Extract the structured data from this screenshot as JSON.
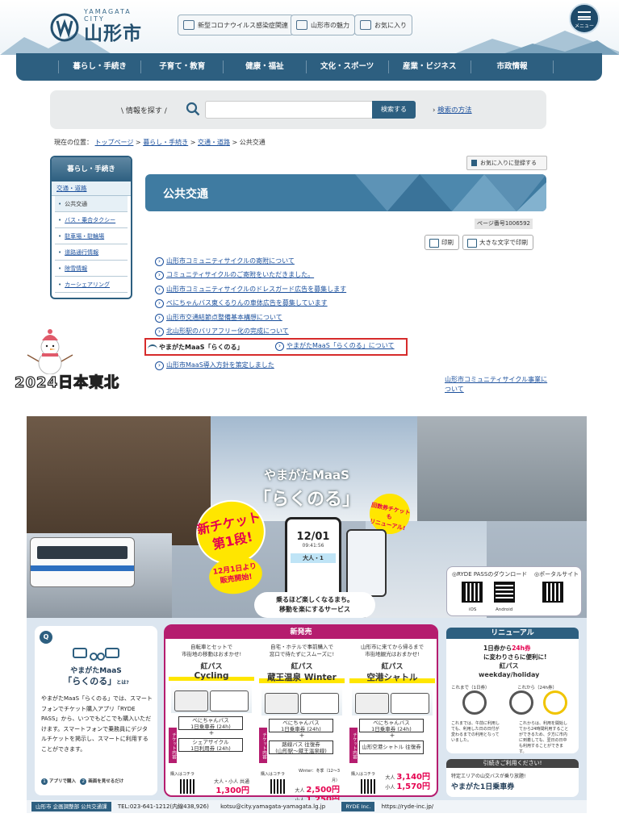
{
  "header": {
    "logo_en": "YAMAGATA CITY",
    "logo_jp": "山形市",
    "buttons": [
      "新型コロナウイルス感染症関連",
      "山形市の魅力",
      "お気に入り"
    ],
    "menu_label": "メニュー"
  },
  "nav": [
    "暮らし・手続き",
    "子育て・教育",
    "健康・福祉",
    "文化・スポーツ",
    "産業・ビジネス",
    "市政情報"
  ],
  "search": {
    "label": "情報を探す",
    "placeholder": "",
    "button": "検索する",
    "how": "検索の方法"
  },
  "breadcrumb": {
    "prefix": "現在の位置：",
    "items": [
      "トップページ",
      "暮らし・手続き",
      "交通・道路"
    ],
    "current": "公共交通"
  },
  "sidebar": {
    "heading": "暮らし・手続き",
    "sub": "交通・道路",
    "items": [
      "公共交通",
      "バス・乗合タクシー",
      "駐車場・駐輪場",
      "道路通行情報",
      "除雪情報",
      "カーシェアリング"
    ]
  },
  "main": {
    "fav_button": "お気に入りに登録する",
    "title": "公共交通",
    "page_no": "ページ番号1006592",
    "print": "印刷",
    "print_large": "大きな文字で印刷",
    "links": [
      "山形市コミュニティサイクルの寄附について",
      "コミュニティサイクルのご寄附をいただきました。",
      "山形市コミュニティサイクルのドレスガード広告を募集します",
      "べにちゃんバス東くるりんの車体広告を募集しています",
      "山形市交通結節点整備基本構想について",
      "北山形駅のバリアフリー化の完成について"
    ],
    "maas_logo": "やまがたMaaS「らくのる」",
    "maas_link": "やまがたMaaS「らくのる」について",
    "last_link": "山形市MaaS導入方針を策定しました",
    "side_link": "山形市コミュニティサイクル事業について"
  },
  "watermark": "2024日本東北",
  "poster": {
    "title_a": "やまがたMaaS",
    "title_b": "「らくのる」",
    "badge1": [
      "新チケット",
      "第1段!"
    ],
    "badge2": [
      "12月1日より",
      "販売開始!"
    ],
    "badge3": [
      "回数券チケットも",
      "リニューアル!"
    ],
    "phone_date": "12/01",
    "phone_time": "09:41:56",
    "phone_count": "大人・1",
    "caption": [
      "乗るほど楽しくなるまち。",
      "移動を楽にするサービス"
    ],
    "qr_ryde": "◎RYDE PASSのダウンロード",
    "qr_portal": "◎ポータルサイト",
    "qr_ios": "iOS",
    "qr_android": "Android",
    "about_q": "Q",
    "about_t1": "やまがたMaaS",
    "about_t2": "「らくのる」",
    "about_t2_suffix": "とは?",
    "about_desc": "やまがたMaaS「らくのる」では、スマートフォンでチケット購入アプリ「RYDE PASS」から、いつでもどこでも購入いただけます。スマートフォンで乗務員にデジタルチケットを掲示し、スマートに利用することができます。",
    "about_steps": [
      "アプリで購入",
      "画面を見せるだけ"
    ],
    "new_heading": "新発売",
    "columns": [
      {
        "desc": [
          "自転車とセットで",
          "市街地の移動はおまかせ!"
        ],
        "name1": "紅パス",
        "name2": "Cycling",
        "tickets": [
          "べにちゃんバス",
          "1日乗車券 (24h)",
          "シェアサイクル",
          "1日利用券 (24h)"
        ],
        "side": "チケット内容",
        "buy": "購入はコチラ",
        "price_label": "大人・小人 共通",
        "price": "1,300円"
      },
      {
        "desc": [
          "自宅・ホテルで事前購入で",
          "窓口で待たずにスムーズに!"
        ],
        "name1": "紅パス",
        "name2": "蔵王温泉 Winter",
        "tickets": [
          "べにちゃんバス",
          "1日乗車券 (24h)",
          "路線バス 往復券",
          "(山形駅～蔵王温泉線)"
        ],
        "side": "チケット内容",
        "buy": "購入はコチラ",
        "price_label": "Winter：冬季（12～3月）",
        "price_adult_label": "大人",
        "price": "2,500円",
        "price_child_label": "小人",
        "price_child": "1,250円"
      },
      {
        "desc": [
          "山形市に来てから帰るまで",
          "市街地観光はおまかせ!"
        ],
        "name1": "紅パス",
        "name2": "空港シャトル",
        "tickets": [
          "べにちゃんバス",
          "1日乗車券 (24h)",
          "山形空港シャトル 往復券"
        ],
        "side": "チケット内容",
        "buy": "購入はコチラ",
        "price_adult_label": "大人",
        "price": "3,140円",
        "price_child_label": "小人",
        "price_child": "1,570円"
      }
    ],
    "renew_heading": "リニューアル",
    "renew_l1_a": "1日券から",
    "renew_l1_b": "24h券",
    "renew_l1_c": "に変わりさらに便利に!",
    "renew_l2": [
      "紅パス",
      "weekday/holiday"
    ],
    "renew_before": "これまで（1日券）",
    "renew_after": "これから（24h券）",
    "renew_before_desc": "これまでは、午前に利用しても、利用した日の日付が変わるまでの利用となっていました。",
    "renew_after_desc": "これからは、利用を開始してから24時間利用することができるため、夕方に市内に到着しても、翌日の日中も利用することができます。",
    "oneday_heading": "引続きご利用ください!",
    "oneday_a": "特定エリアの山交バスが乗り放題!",
    "oneday_b": "やまがた1日乗車券",
    "footer": {
      "org": "山形市 企画調整部 公共交通課",
      "tel": "TEL:023-641-1212(内線438,926)",
      "mail": "kotsu@city.yamagata-yamagata.lg.jp",
      "ryde": "RYDE Inc.",
      "url": "https://ryde-inc.jp/"
    }
  }
}
